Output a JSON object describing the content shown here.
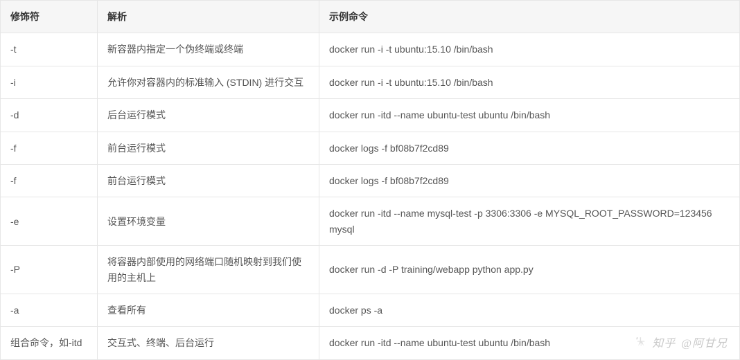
{
  "table": {
    "headers": [
      "修饰符",
      "解析",
      "示例命令"
    ],
    "rows": [
      {
        "flag": "-t",
        "desc": "新容器内指定一个伪终端或终端",
        "cmd": "docker run -i -t ubuntu:15.10 /bin/bash"
      },
      {
        "flag": "-i",
        "desc": "允许你对容器内的标准输入 (STDIN) 进行交互",
        "cmd": "docker run -i -t ubuntu:15.10 /bin/bash"
      },
      {
        "flag": "-d",
        "desc": "后台运行模式",
        "cmd": "docker run -itd --name ubuntu-test ubuntu /bin/bash"
      },
      {
        "flag": "-f",
        "desc": "前台运行模式",
        "cmd": "docker logs -f bf08b7f2cd89"
      },
      {
        "flag": "-f",
        "desc": "前台运行模式",
        "cmd": "docker logs -f bf08b7f2cd89"
      },
      {
        "flag": "-e",
        "desc": "设置环境变量",
        "cmd": "docker run -itd --name mysql-test -p 3306:3306 -e MYSQL_ROOT_PASSWORD=123456 mysql"
      },
      {
        "flag": "-P",
        "desc": "将容器内部使用的网络端口随机映射到我们使用的主机上",
        "cmd": "docker run -d -P training/webapp python app.py"
      },
      {
        "flag": "-a",
        "desc": "查看所有",
        "cmd": "docker ps -a"
      },
      {
        "flag": "组合命令，如-itd",
        "desc": "交互式、终端、后台运行",
        "cmd": "docker run -itd --name ubuntu-test ubuntu /bin/bash"
      }
    ]
  },
  "watermark": {
    "site": "知乎",
    "author": "@阿甘兄"
  }
}
